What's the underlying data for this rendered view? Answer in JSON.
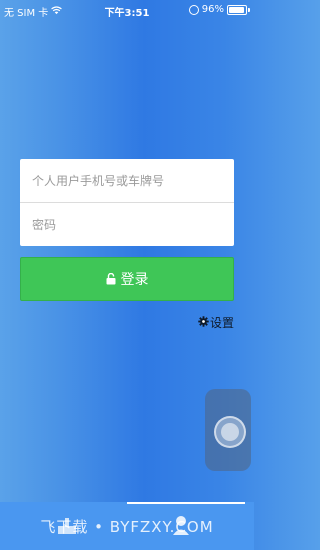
{
  "status_bar": {
    "carrier": "无 SIM 卡",
    "time": "下午3:51",
    "battery": "96%",
    "battery_level": 0.96
  },
  "login": {
    "phone_placeholder": "个人用户手机号或车牌号",
    "password_placeholder": "密码",
    "login_label": "登录",
    "settings_label": "设置"
  },
  "watermark": {
    "text": "飞下载 • BYFZXY.COM"
  },
  "colors": {
    "background_center": "#2f79e3",
    "login_button": "#3fc657",
    "bottom_bar": "#4a97f0"
  },
  "icons": {
    "wifi": "wifi-icon",
    "lock": "lock-icon",
    "settings": "gear-icon",
    "assistive": "assistive-touch-icon"
  }
}
